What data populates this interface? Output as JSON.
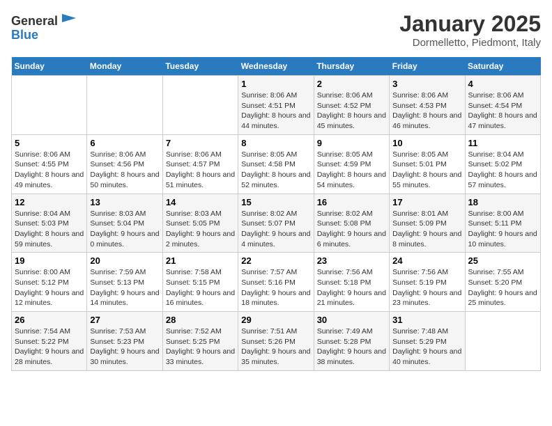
{
  "logo": {
    "line1": "General",
    "line2": "Blue"
  },
  "title": "January 2025",
  "subtitle": "Dormelletto, Piedmont, Italy",
  "days_of_week": [
    "Sunday",
    "Monday",
    "Tuesday",
    "Wednesday",
    "Thursday",
    "Friday",
    "Saturday"
  ],
  "weeks": [
    [
      {
        "day": "",
        "info": ""
      },
      {
        "day": "",
        "info": ""
      },
      {
        "day": "",
        "info": ""
      },
      {
        "day": "1",
        "info": "Sunrise: 8:06 AM\nSunset: 4:51 PM\nDaylight: 8 hours and 44 minutes."
      },
      {
        "day": "2",
        "info": "Sunrise: 8:06 AM\nSunset: 4:52 PM\nDaylight: 8 hours and 45 minutes."
      },
      {
        "day": "3",
        "info": "Sunrise: 8:06 AM\nSunset: 4:53 PM\nDaylight: 8 hours and 46 minutes."
      },
      {
        "day": "4",
        "info": "Sunrise: 8:06 AM\nSunset: 4:54 PM\nDaylight: 8 hours and 47 minutes."
      }
    ],
    [
      {
        "day": "5",
        "info": "Sunrise: 8:06 AM\nSunset: 4:55 PM\nDaylight: 8 hours and 49 minutes."
      },
      {
        "day": "6",
        "info": "Sunrise: 8:06 AM\nSunset: 4:56 PM\nDaylight: 8 hours and 50 minutes."
      },
      {
        "day": "7",
        "info": "Sunrise: 8:06 AM\nSunset: 4:57 PM\nDaylight: 8 hours and 51 minutes."
      },
      {
        "day": "8",
        "info": "Sunrise: 8:05 AM\nSunset: 4:58 PM\nDaylight: 8 hours and 52 minutes."
      },
      {
        "day": "9",
        "info": "Sunrise: 8:05 AM\nSunset: 4:59 PM\nDaylight: 8 hours and 54 minutes."
      },
      {
        "day": "10",
        "info": "Sunrise: 8:05 AM\nSunset: 5:01 PM\nDaylight: 8 hours and 55 minutes."
      },
      {
        "day": "11",
        "info": "Sunrise: 8:04 AM\nSunset: 5:02 PM\nDaylight: 8 hours and 57 minutes."
      }
    ],
    [
      {
        "day": "12",
        "info": "Sunrise: 8:04 AM\nSunset: 5:03 PM\nDaylight: 8 hours and 59 minutes."
      },
      {
        "day": "13",
        "info": "Sunrise: 8:03 AM\nSunset: 5:04 PM\nDaylight: 9 hours and 0 minutes."
      },
      {
        "day": "14",
        "info": "Sunrise: 8:03 AM\nSunset: 5:05 PM\nDaylight: 9 hours and 2 minutes."
      },
      {
        "day": "15",
        "info": "Sunrise: 8:02 AM\nSunset: 5:07 PM\nDaylight: 9 hours and 4 minutes."
      },
      {
        "day": "16",
        "info": "Sunrise: 8:02 AM\nSunset: 5:08 PM\nDaylight: 9 hours and 6 minutes."
      },
      {
        "day": "17",
        "info": "Sunrise: 8:01 AM\nSunset: 5:09 PM\nDaylight: 9 hours and 8 minutes."
      },
      {
        "day": "18",
        "info": "Sunrise: 8:00 AM\nSunset: 5:11 PM\nDaylight: 9 hours and 10 minutes."
      }
    ],
    [
      {
        "day": "19",
        "info": "Sunrise: 8:00 AM\nSunset: 5:12 PM\nDaylight: 9 hours and 12 minutes."
      },
      {
        "day": "20",
        "info": "Sunrise: 7:59 AM\nSunset: 5:13 PM\nDaylight: 9 hours and 14 minutes."
      },
      {
        "day": "21",
        "info": "Sunrise: 7:58 AM\nSunset: 5:15 PM\nDaylight: 9 hours and 16 minutes."
      },
      {
        "day": "22",
        "info": "Sunrise: 7:57 AM\nSunset: 5:16 PM\nDaylight: 9 hours and 18 minutes."
      },
      {
        "day": "23",
        "info": "Sunrise: 7:56 AM\nSunset: 5:18 PM\nDaylight: 9 hours and 21 minutes."
      },
      {
        "day": "24",
        "info": "Sunrise: 7:56 AM\nSunset: 5:19 PM\nDaylight: 9 hours and 23 minutes."
      },
      {
        "day": "25",
        "info": "Sunrise: 7:55 AM\nSunset: 5:20 PM\nDaylight: 9 hours and 25 minutes."
      }
    ],
    [
      {
        "day": "26",
        "info": "Sunrise: 7:54 AM\nSunset: 5:22 PM\nDaylight: 9 hours and 28 minutes."
      },
      {
        "day": "27",
        "info": "Sunrise: 7:53 AM\nSunset: 5:23 PM\nDaylight: 9 hours and 30 minutes."
      },
      {
        "day": "28",
        "info": "Sunrise: 7:52 AM\nSunset: 5:25 PM\nDaylight: 9 hours and 33 minutes."
      },
      {
        "day": "29",
        "info": "Sunrise: 7:51 AM\nSunset: 5:26 PM\nDaylight: 9 hours and 35 minutes."
      },
      {
        "day": "30",
        "info": "Sunrise: 7:49 AM\nSunset: 5:28 PM\nDaylight: 9 hours and 38 minutes."
      },
      {
        "day": "31",
        "info": "Sunrise: 7:48 AM\nSunset: 5:29 PM\nDaylight: 9 hours and 40 minutes."
      },
      {
        "day": "",
        "info": ""
      }
    ]
  ]
}
